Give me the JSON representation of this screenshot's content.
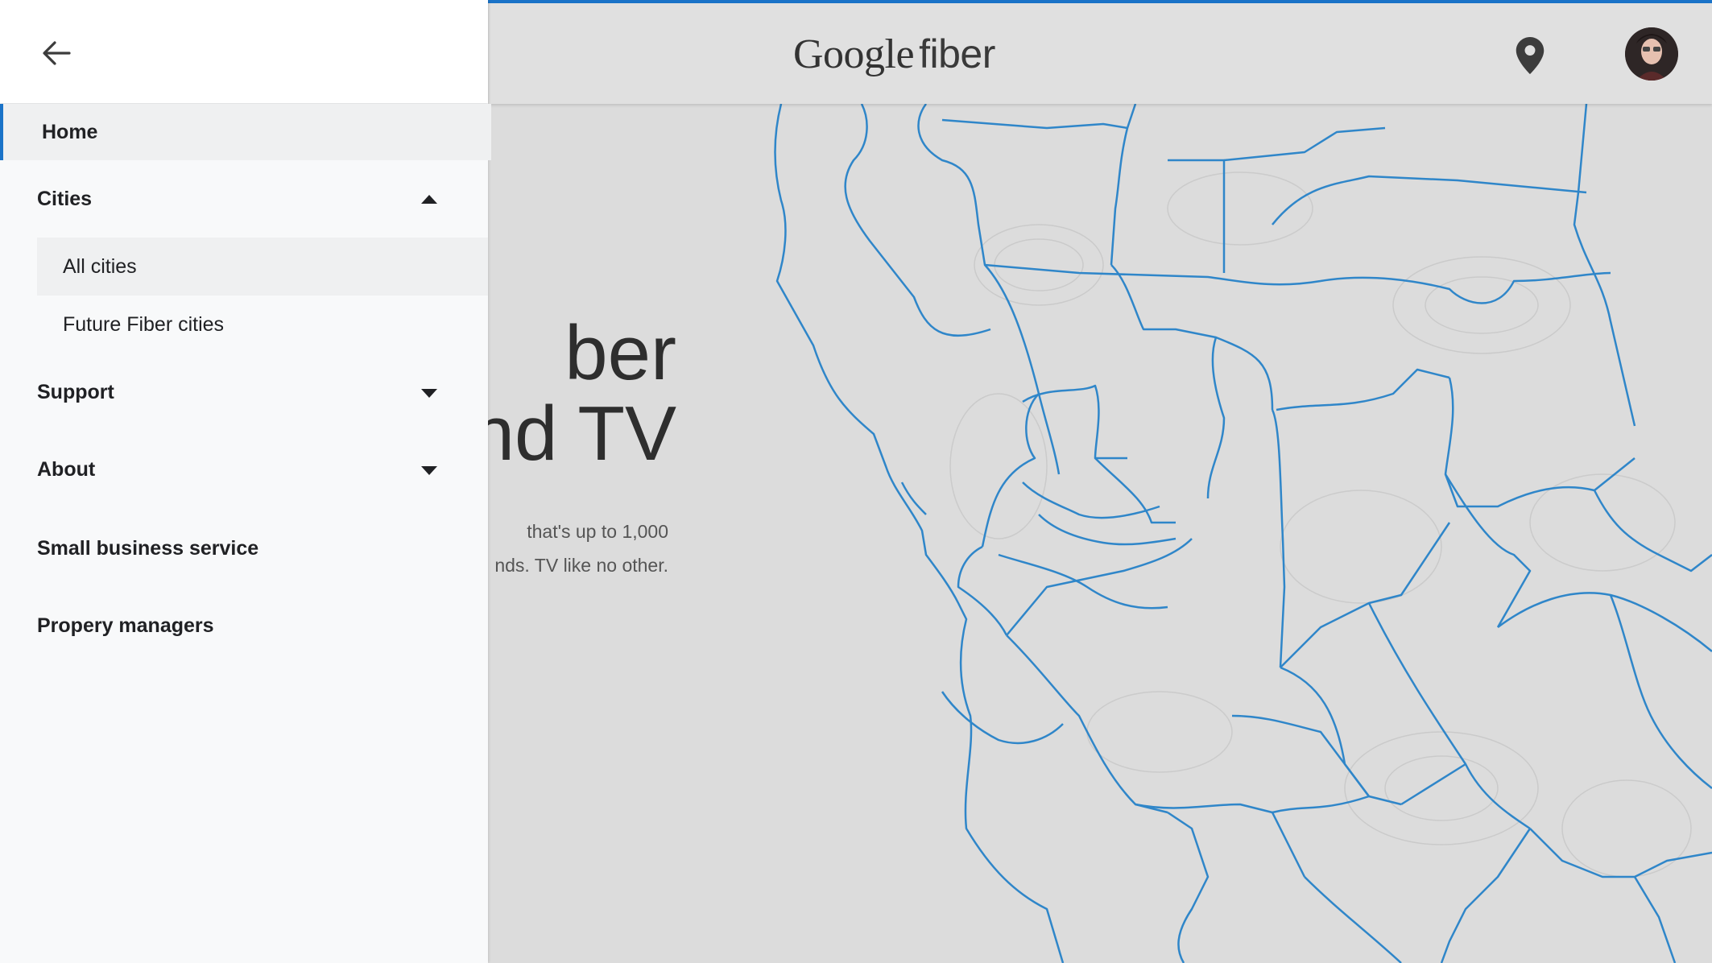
{
  "header": {
    "logo_google": "Google",
    "logo_fiber": "fiber",
    "location_icon": "location-pin-icon",
    "avatar_icon": "user-avatar"
  },
  "hero": {
    "title_line1": "ber",
    "title_line2": "nd TV",
    "sub_line1": "that's up to 1,000",
    "sub_line2": "nds. TV like no other."
  },
  "drawer": {
    "back_icon": "arrow-left-icon",
    "home": "Home",
    "cities": {
      "label": "Cities",
      "expanded": true,
      "items": [
        "All cities",
        "Future Fiber cities"
      ]
    },
    "support": "Support",
    "about": "About",
    "small_business": "Small business service",
    "property_managers": "Propery managers"
  },
  "colors": {
    "accent": "#1a73c8",
    "drawer_bg": "#f8f9fa",
    "map_line": "#2f86c9"
  }
}
